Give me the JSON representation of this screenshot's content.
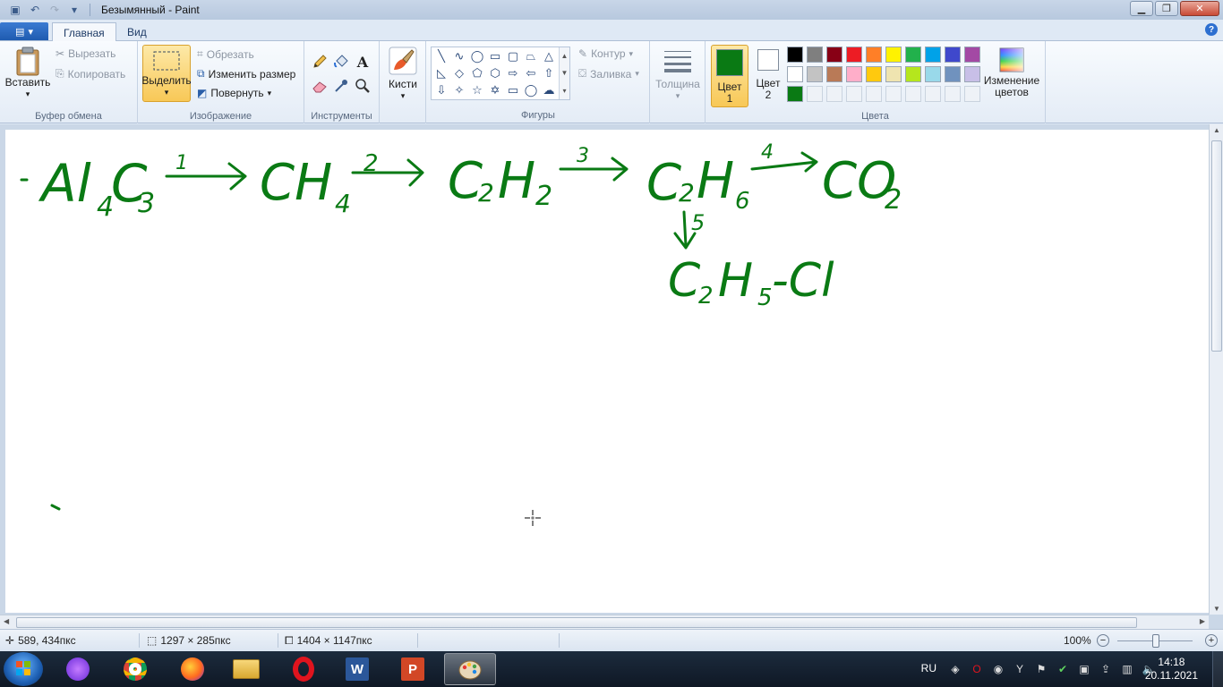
{
  "window": {
    "title": "Безымянный - Paint"
  },
  "menu": {
    "tabs": [
      "Главная",
      "Вид"
    ]
  },
  "ribbon": {
    "clipboard": {
      "label": "Буфер обмена",
      "paste": "Вставить",
      "cut": "Вырезать",
      "copy": "Копировать"
    },
    "image": {
      "label": "Изображение",
      "select": "Выделить",
      "crop": "Обрезать",
      "resize": "Изменить размер",
      "rotate": "Повернуть"
    },
    "tools": {
      "label": "Инструменты"
    },
    "brushes": {
      "label": "Кисти"
    },
    "shapes": {
      "label": "Фигуры",
      "outline": "Контур",
      "fill": "Заливка"
    },
    "size": {
      "label": "Толщина"
    },
    "colors": {
      "label": "Цвета",
      "color1_line1": "Цвет",
      "color1_line2": "1",
      "color2_line1": "Цвет",
      "color2_line2": "2",
      "edit_line1": "Изменение",
      "edit_line2": "цветов",
      "color1_value": "#0a7a14",
      "color2_value": "#ffffff",
      "palette_row1": [
        "#000000",
        "#7f7f7f",
        "#880015",
        "#ed1c24",
        "#ff7f27",
        "#fff200",
        "#22b14c",
        "#00a2e8",
        "#3f48cc",
        "#a349a4"
      ],
      "palette_row2": [
        "#ffffff",
        "#c3c3c3",
        "#b97a57",
        "#ffaec9",
        "#ffc90e",
        "#efe4b0",
        "#b5e61d",
        "#99d9ea",
        "#7092be",
        "#c8bfe7"
      ],
      "palette_row3": [
        "#0a7a14",
        "",
        "",
        "",
        "",
        "",
        "",
        "",
        "",
        ""
      ]
    }
  },
  "canvas": {
    "ink_color": "#0a7a14",
    "chem": {
      "f1": "Al",
      "f1s1": "4",
      "f1b": "C",
      "f1s2": "3",
      "a1": "1",
      "f2": "CH",
      "f2s": "4",
      "a2": "2",
      "f3a": "C",
      "f3s1": "2",
      "f3b": "H",
      "f3s2": "2",
      "a3": "3",
      "f4a": "C",
      "f4s1": "2",
      "f4b": "H",
      "f4s2": "6",
      "a4": "4",
      "f5a": "CO",
      "f5s": "2",
      "a5": "5",
      "f6a": "C",
      "f6s1": "2",
      "f6b": "H",
      "f6s2": "5",
      "f6c": "-Cl"
    }
  },
  "status": {
    "cursor_pos": "589, 434пкс",
    "selection_size": "1297 × 285пкс",
    "image_size": "1404 × 1147пкс",
    "zoom": "100%"
  },
  "taskbar": {
    "lang": "RU",
    "time": "14:18",
    "date": "20.11.2021"
  }
}
